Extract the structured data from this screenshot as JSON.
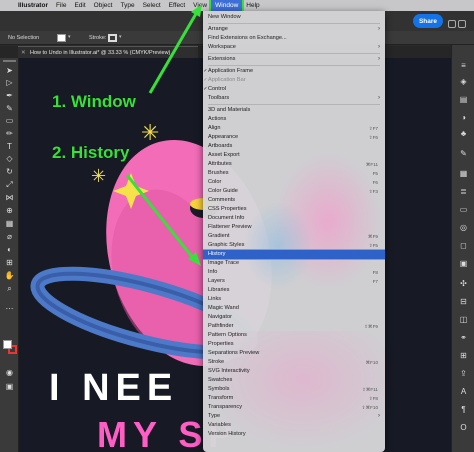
{
  "menubar": {
    "apple_glyph": "",
    "items": [
      "Illustrator",
      "File",
      "Edit",
      "Object",
      "Type",
      "Select",
      "Effect",
      "View",
      "Window",
      "Help"
    ]
  },
  "appbar": {
    "share_label": "Share"
  },
  "control": {
    "selection_label": "No Selection",
    "stroke_label": "Stroke:"
  },
  "document_tab": {
    "title": "How to Undo in Illustrator.ai* @ 33.33 % (CMYK/Preview)"
  },
  "window_menu": {
    "items": [
      {
        "label": "New Window"
      },
      {
        "sep": true
      },
      {
        "label": "Arrange",
        "arrow": true
      },
      {
        "label": "Find Extensions on Exchange..."
      },
      {
        "label": "Workspace",
        "arrow": true
      },
      {
        "sep": true
      },
      {
        "label": "Extensions",
        "arrow": true
      },
      {
        "sep": true
      },
      {
        "label": "Application Frame",
        "check": true
      },
      {
        "label": "Application Bar",
        "check": true,
        "disabled": true
      },
      {
        "label": "Control",
        "check": true
      },
      {
        "label": "Toolbars",
        "arrow": true
      },
      {
        "sep": true
      },
      {
        "label": "3D and Materials"
      },
      {
        "label": "Actions"
      },
      {
        "label": "Align",
        "shortcut": "⇧F7"
      },
      {
        "label": "Appearance",
        "shortcut": "⇧F6"
      },
      {
        "label": "Artboards"
      },
      {
        "label": "Asset Export"
      },
      {
        "label": "Attributes",
        "shortcut": "⌘F11"
      },
      {
        "label": "Brushes",
        "shortcut": "F5"
      },
      {
        "label": "Color",
        "shortcut": "F6"
      },
      {
        "label": "Color Guide",
        "shortcut": "⇧F3"
      },
      {
        "label": "Comments"
      },
      {
        "label": "CSS Properties"
      },
      {
        "label": "Document Info"
      },
      {
        "label": "Flattener Preview"
      },
      {
        "label": "Gradient",
        "shortcut": "⌘F9"
      },
      {
        "label": "Graphic Styles",
        "shortcut": "⇧F5"
      },
      {
        "label": "History",
        "highlight": true
      },
      {
        "label": "Image Trace"
      },
      {
        "label": "Info",
        "shortcut": "F8"
      },
      {
        "label": "Layers",
        "shortcut": "F7"
      },
      {
        "label": "Libraries"
      },
      {
        "label": "Links"
      },
      {
        "label": "Magic Wand"
      },
      {
        "label": "Navigator"
      },
      {
        "label": "Pathfinder",
        "shortcut": "⇧⌘F9"
      },
      {
        "label": "Pattern Options"
      },
      {
        "label": "Properties"
      },
      {
        "label": "Separations Preview"
      },
      {
        "label": "Stroke",
        "shortcut": "⌘F10"
      },
      {
        "label": "SVG Interactivity"
      },
      {
        "label": "Swatches"
      },
      {
        "label": "Symbols",
        "shortcut": "⇧⌘F11"
      },
      {
        "label": "Transform",
        "shortcut": "⇧F8"
      },
      {
        "label": "Transparency",
        "shortcut": "⇧⌘F10"
      },
      {
        "label": "Type",
        "arrow": true
      },
      {
        "label": "Variables"
      },
      {
        "label": "Version History"
      }
    ]
  },
  "annotations": {
    "step1": "1. Window",
    "step2": "2. History"
  },
  "artwork": {
    "line1": "I NEE",
    "line2": "MY SP"
  },
  "colors": {
    "annotation_green": "#37e03a",
    "highlight_blue": "#2f62c9",
    "share_blue": "#1473e6",
    "planet_pink": "#f26cb8",
    "ring_blue": "#4d79c9",
    "star_yellow": "#f5e14a",
    "text_pink": "#ff5ec4"
  }
}
